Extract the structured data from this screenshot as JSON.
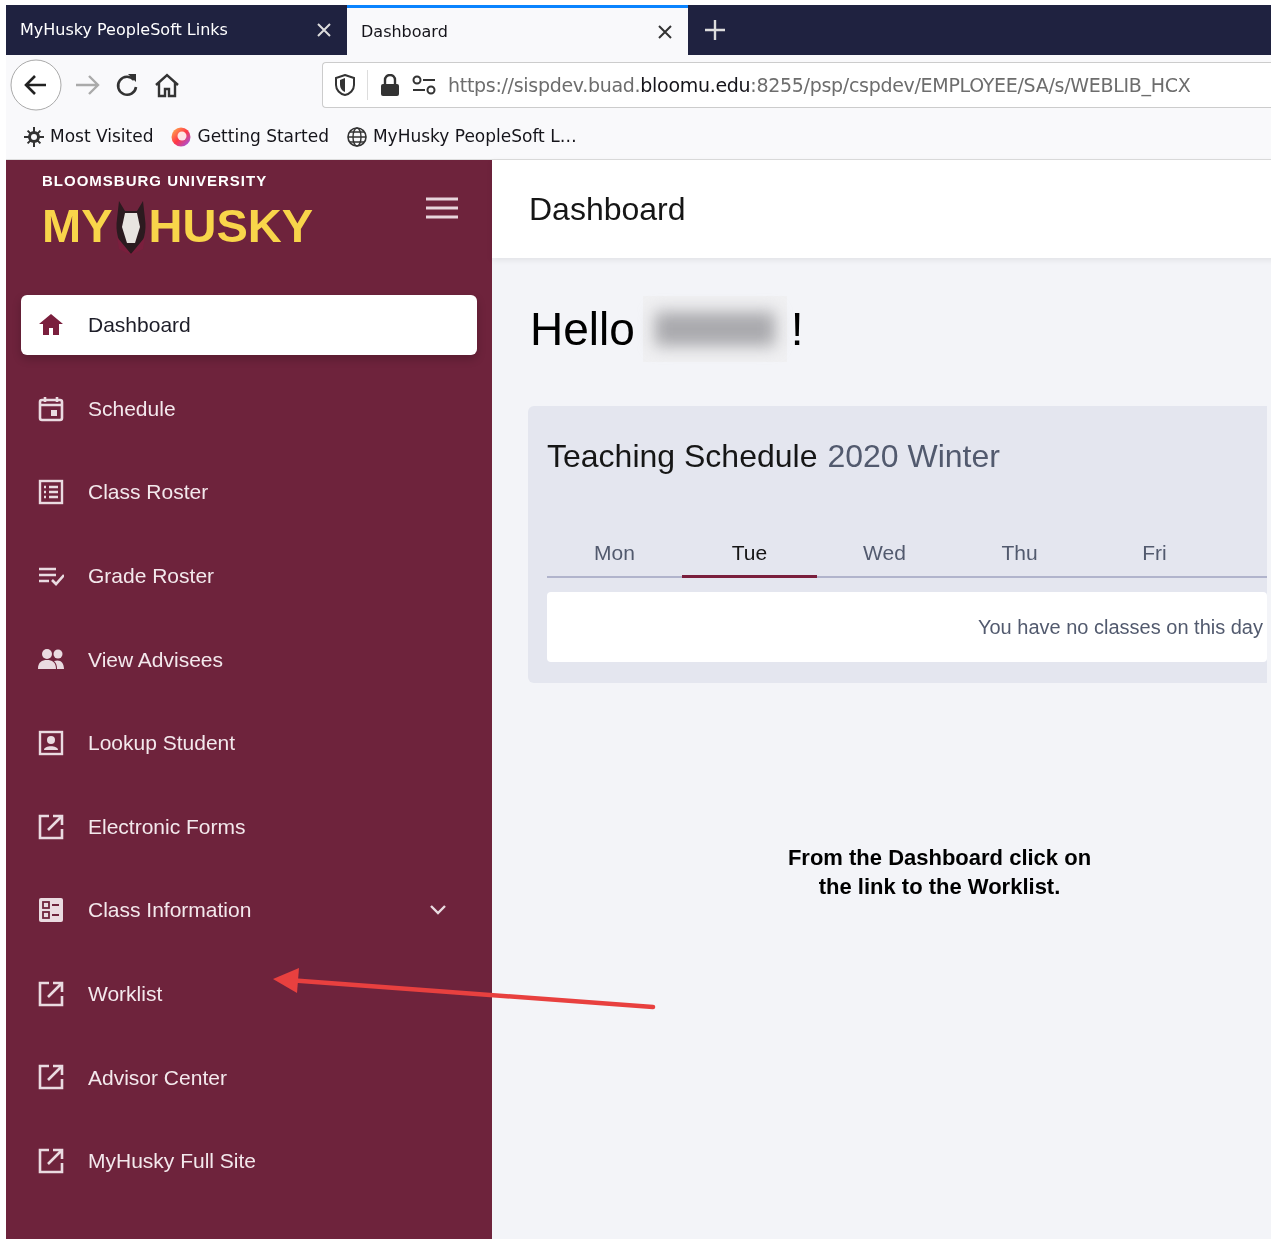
{
  "browser": {
    "tabs": [
      {
        "label": "MyHusky PeopleSoft Links",
        "selected": false
      },
      {
        "label": "Dashboard",
        "selected": true
      }
    ],
    "url": {
      "prefix": "https://sispdev.buad.",
      "domain": "bloomu.edu",
      "suffix": ":8255/psp/cspdev/EMPLOYEE/SA/s/WEBLIB_HCX"
    },
    "bookmarks": [
      "Most Visited",
      "Getting Started",
      "MyHusky PeopleSoft L…"
    ]
  },
  "sidebar": {
    "university": "BLOOMSBURG UNIVERSITY",
    "logo_left": "MY",
    "logo_right": "HUSKY",
    "items": [
      {
        "label": "Dashboard",
        "kind": "link",
        "selected": true
      },
      {
        "label": "Schedule",
        "kind": "link",
        "selected": false
      },
      {
        "label": "Class Roster",
        "kind": "link",
        "selected": false
      },
      {
        "label": "Grade Roster",
        "kind": "link",
        "selected": false
      },
      {
        "label": "View Advisees",
        "kind": "link",
        "selected": false
      },
      {
        "label": "Lookup Student",
        "kind": "link",
        "selected": false
      },
      {
        "label": "Electronic Forms",
        "kind": "link",
        "selected": false
      },
      {
        "label": "Class Information",
        "kind": "group",
        "selected": false
      },
      {
        "label": "Worklist",
        "kind": "link",
        "selected": false
      },
      {
        "label": "Advisor Center",
        "kind": "link",
        "selected": false
      },
      {
        "label": "MyHusky Full Site",
        "kind": "link",
        "selected": false
      }
    ]
  },
  "header": {
    "title": "Dashboard"
  },
  "greeting": {
    "hello": "Hello",
    "punct": "!"
  },
  "schedule": {
    "title": "Teaching Schedule",
    "term": "2020 Winter",
    "days": [
      {
        "label": "Mon",
        "selected": false
      },
      {
        "label": "Tue",
        "selected": true
      },
      {
        "label": "Wed",
        "selected": false
      },
      {
        "label": "Thu",
        "selected": false
      },
      {
        "label": "Fri",
        "selected": false
      }
    ],
    "empty_message": "You have no classes on this day"
  },
  "annotation": {
    "lines": [
      "From the Dashboard click on",
      "the link to the Worklist."
    ]
  }
}
